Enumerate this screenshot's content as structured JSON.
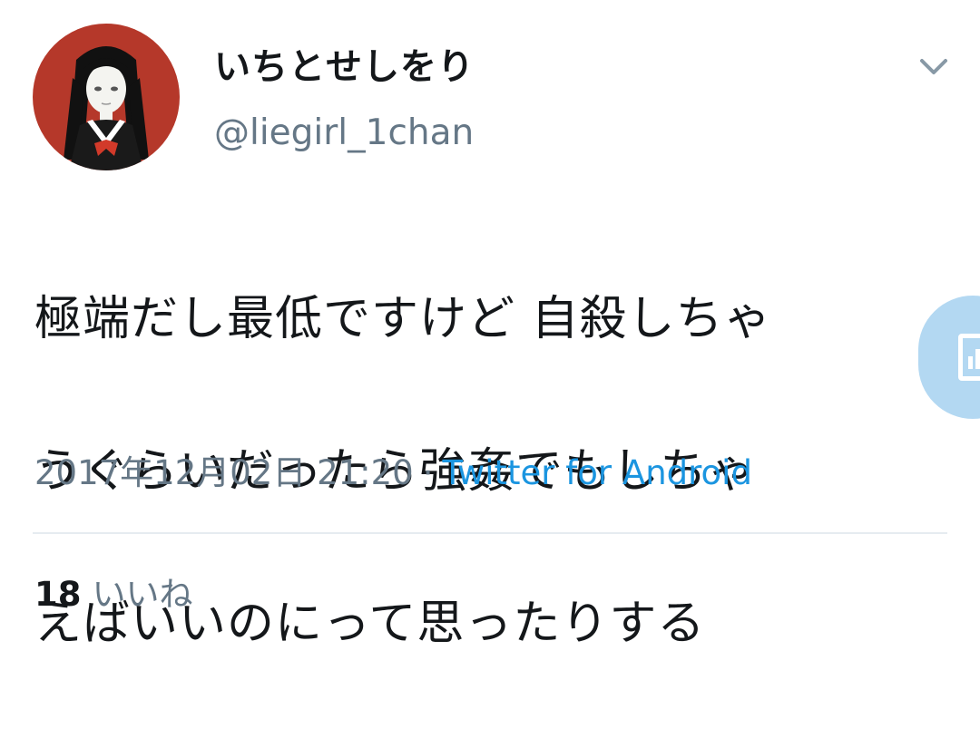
{
  "tweet": {
    "display_name": "いちとせしをり",
    "handle": "@liegirl_1chan",
    "text_lines": [
      "極端だし最低ですけど 自殺しちゃ",
      "うぐらいだったら強姦でもしちゃ",
      "えばいいのにって思ったりする"
    ],
    "timestamp": "2017年12月02日 21:20",
    "separator": "·",
    "source": "Twitter for Android",
    "likes_count": "18",
    "likes_label": "いいね"
  },
  "icons": {
    "menu": "chevron-down-icon",
    "floating": "report-icon"
  },
  "colors": {
    "text": "#14171a",
    "secondary": "#657786",
    "link": "#1b95e0",
    "avatar_bg": "#b5382a",
    "divider": "#e6ecf0",
    "fab": "#b3d8f2"
  }
}
